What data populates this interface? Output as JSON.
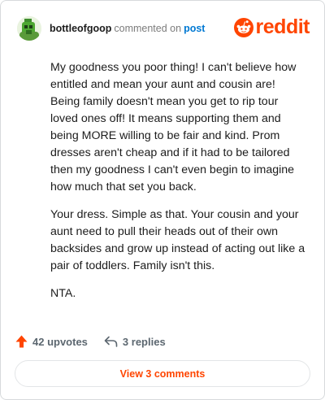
{
  "comment": {
    "username": "bottleofgoop",
    "action_text": "commented on",
    "target_link": "post",
    "paragraphs": [
      "My goodness you poor thing! I can't believe how entitled and mean your aunt and cousin are! Being family doesn't mean you get to rip tour loved ones off! It means supporting them and being MORE willing to be fair and kind. Prom dresses aren't cheap and if it had to be tailored then my goodness I can't even begin to imagine how much that set you back.",
      "Your dress. Simple as that. Your cousin and your aunt need to pull their heads out of their own backsides and grow up instead of acting out like a pair of toddlers. Family isn't this.",
      "NTA."
    ],
    "upvotes_label": "42 upvotes",
    "replies_label": "3 replies",
    "view_comments_label": "View 3 comments"
  },
  "brand": {
    "wordmark": "reddit"
  },
  "icons": {
    "avatar": "user-avatar",
    "logo": "reddit-logo-icon",
    "upvote": "upvote-arrow-icon",
    "reply": "reply-arrow-icon"
  },
  "colors": {
    "accent": "#ff4500",
    "link": "#0079d3",
    "muted": "#7c7c7c",
    "border": "#d7dadc"
  }
}
